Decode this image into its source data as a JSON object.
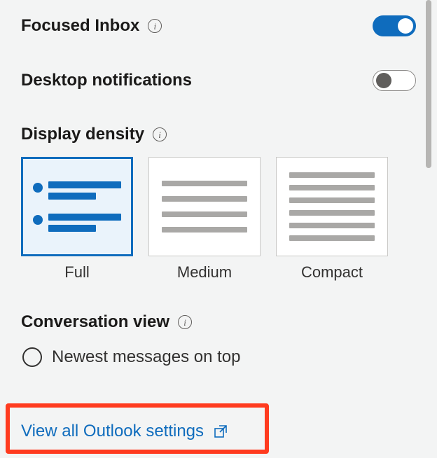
{
  "settings": {
    "focusedInbox": {
      "label": "Focused Inbox",
      "enabled": true
    },
    "desktopNotifications": {
      "label": "Desktop notifications",
      "enabled": false
    },
    "displayDensity": {
      "label": "Display density",
      "options": {
        "full": "Full",
        "medium": "Medium",
        "compact": "Compact"
      },
      "selected": "full"
    },
    "conversationView": {
      "label": "Conversation view",
      "option1": "Newest messages on top"
    }
  },
  "footer": {
    "viewAll": "View all Outlook settings"
  }
}
